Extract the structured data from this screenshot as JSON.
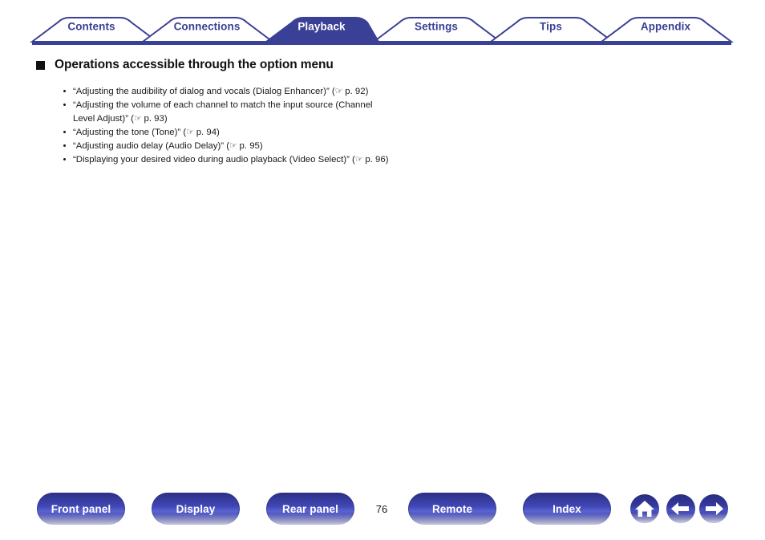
{
  "colors": {
    "brand_indigo": "#3a4095",
    "tab_active_bg": "#3a4095",
    "tab_inactive_text": "#3a4095",
    "tab_active_text": "#ffffff",
    "text": "#1a1a1a"
  },
  "tabs": [
    {
      "label": "Contents",
      "active": false
    },
    {
      "label": "Connections",
      "active": false
    },
    {
      "label": "Playback",
      "active": true
    },
    {
      "label": "Settings",
      "active": false
    },
    {
      "label": "Tips",
      "active": false
    },
    {
      "label": "Appendix",
      "active": false
    }
  ],
  "main": {
    "heading": "Operations accessible through the option menu",
    "bullets": [
      {
        "text": "“Adjusting the audibility of dialog and vocals (Dialog Enhancer)” (",
        "icon": "pointing-hand-icon",
        "icon_glyph": "☞",
        "page_ref": " p. 92)"
      },
      {
        "text": "“Adjusting the volume of each channel to match the input source (Channel Level Adjust)” (",
        "icon": "pointing-hand-icon",
        "icon_glyph": "☞",
        "page_ref": " p. 93)"
      },
      {
        "text": "“Adjusting the tone (Tone)” (",
        "icon": "pointing-hand-icon",
        "icon_glyph": "☞",
        "page_ref": " p. 94)"
      },
      {
        "text": "“Adjusting audio delay (Audio Delay)” (",
        "icon": "pointing-hand-icon",
        "icon_glyph": "☞",
        "page_ref": " p. 95)"
      },
      {
        "text": "“Displaying your desired video during audio playback (Video Select)” (",
        "icon": "pointing-hand-icon",
        "icon_glyph": "☞",
        "page_ref": " p. 96)"
      }
    ]
  },
  "footer": {
    "buttons": [
      {
        "label": "Front panel"
      },
      {
        "label": "Display"
      },
      {
        "label": "Rear panel"
      },
      {
        "label": "Remote"
      },
      {
        "label": "Index"
      }
    ],
    "page_number": "76",
    "nav_icons": [
      {
        "name": "home-icon"
      },
      {
        "name": "back-arrow-icon"
      },
      {
        "name": "forward-arrow-icon"
      }
    ]
  }
}
